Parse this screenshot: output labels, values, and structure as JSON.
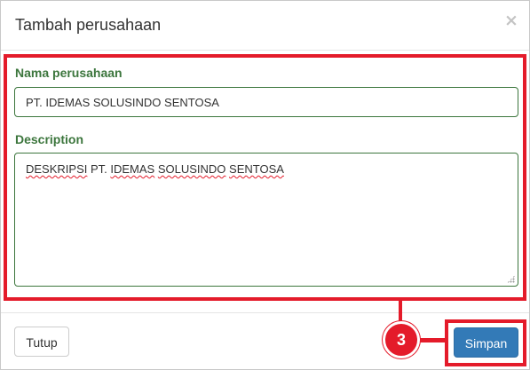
{
  "dialog": {
    "title": "Tambah perusahaan",
    "close_symbol": "×"
  },
  "form": {
    "name_label": "Nama perusahaan",
    "name_value": "PT. IDEMAS SOLUSINDO SENTOSA",
    "description_label": "Description",
    "description_words": [
      "DESKRIPSI",
      " PT. ",
      "IDEMAS",
      " ",
      "SOLUSINDO",
      " ",
      "SENTOSA"
    ]
  },
  "footer": {
    "close_label": "Tutup",
    "save_label": "Simpan"
  },
  "annotation": {
    "step_number": "3",
    "highlight_color": "#e41b2a"
  },
  "colors": {
    "label_green": "#3c763d",
    "primary_blue": "#337ab7"
  }
}
